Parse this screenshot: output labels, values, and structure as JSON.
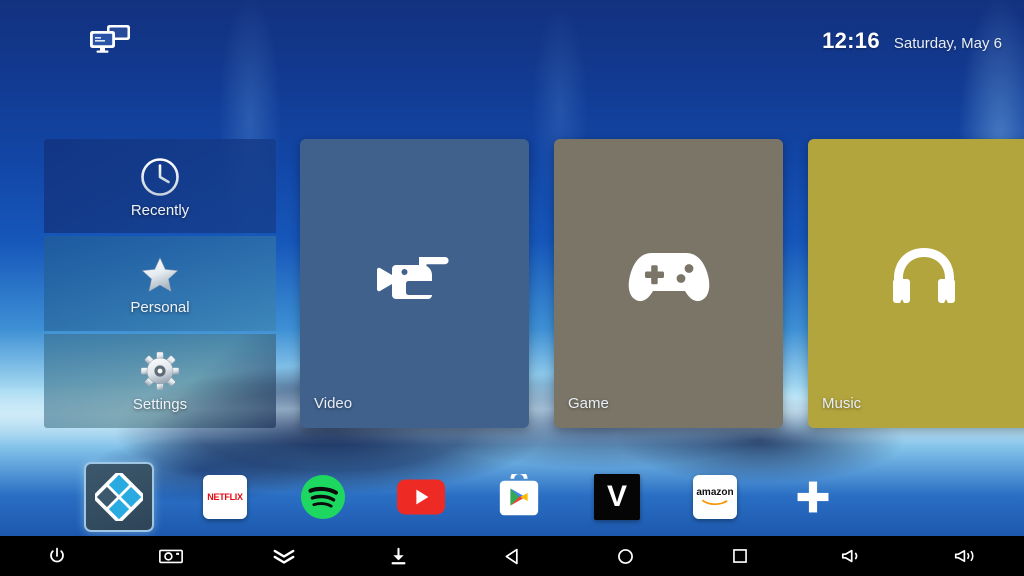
{
  "statusbar": {
    "cast_icon": "screen-mirror-icon",
    "time": "12:16",
    "date": "Saturday, May 6"
  },
  "side_menu": {
    "items": [
      {
        "label": "Recently",
        "icon": "clock-icon"
      },
      {
        "label": "Personal",
        "icon": "star-icon"
      },
      {
        "label": "Settings",
        "icon": "gear-icon"
      }
    ]
  },
  "tiles": [
    {
      "label": "Video",
      "icon": "video-camera-icon",
      "color": "#3f618c"
    },
    {
      "label": "Game",
      "icon": "gamepad-icon",
      "color": "#7a7567"
    },
    {
      "label": "Music",
      "icon": "headphones-icon",
      "color": "#b3a53d"
    }
  ],
  "dock": {
    "apps": [
      {
        "name": "Kodi",
        "icon": "kodi-icon",
        "focused": true
      },
      {
        "name": "Netflix",
        "icon": "netflix-icon",
        "label": "NETFLIX"
      },
      {
        "name": "Spotify",
        "icon": "spotify-icon"
      },
      {
        "name": "YouTube",
        "icon": "youtube-icon"
      },
      {
        "name": "Play Store",
        "icon": "play-store-icon"
      },
      {
        "name": "Vudu",
        "icon": "vudu-icon",
        "label": "V"
      },
      {
        "name": "Amazon",
        "icon": "amazon-icon",
        "label": "amazon"
      },
      {
        "name": "Add",
        "icon": "plus-icon"
      }
    ]
  },
  "navbar": {
    "buttons": [
      {
        "name": "Power",
        "icon": "power-icon"
      },
      {
        "name": "Screenshot",
        "icon": "camera-icon"
      },
      {
        "name": "Notifications",
        "icon": "double-chevron-down-icon"
      },
      {
        "name": "Download",
        "icon": "download-icon"
      },
      {
        "name": "Back",
        "icon": "back-triangle-icon"
      },
      {
        "name": "Home",
        "icon": "home-circle-icon"
      },
      {
        "name": "Recents",
        "icon": "recents-square-icon"
      },
      {
        "name": "Volume Down",
        "icon": "volume-down-icon"
      },
      {
        "name": "Volume Up",
        "icon": "volume-up-icon"
      }
    ]
  },
  "colors": {
    "accent": "#9fc6e3",
    "video_tile": "#3f618c",
    "game_tile": "#7a7567",
    "music_tile": "#b3a53d",
    "netflix_red": "#e50914",
    "spotify_green": "#1ed760",
    "youtube_red": "#ee2a25",
    "amazon_orange": "#f79400"
  }
}
